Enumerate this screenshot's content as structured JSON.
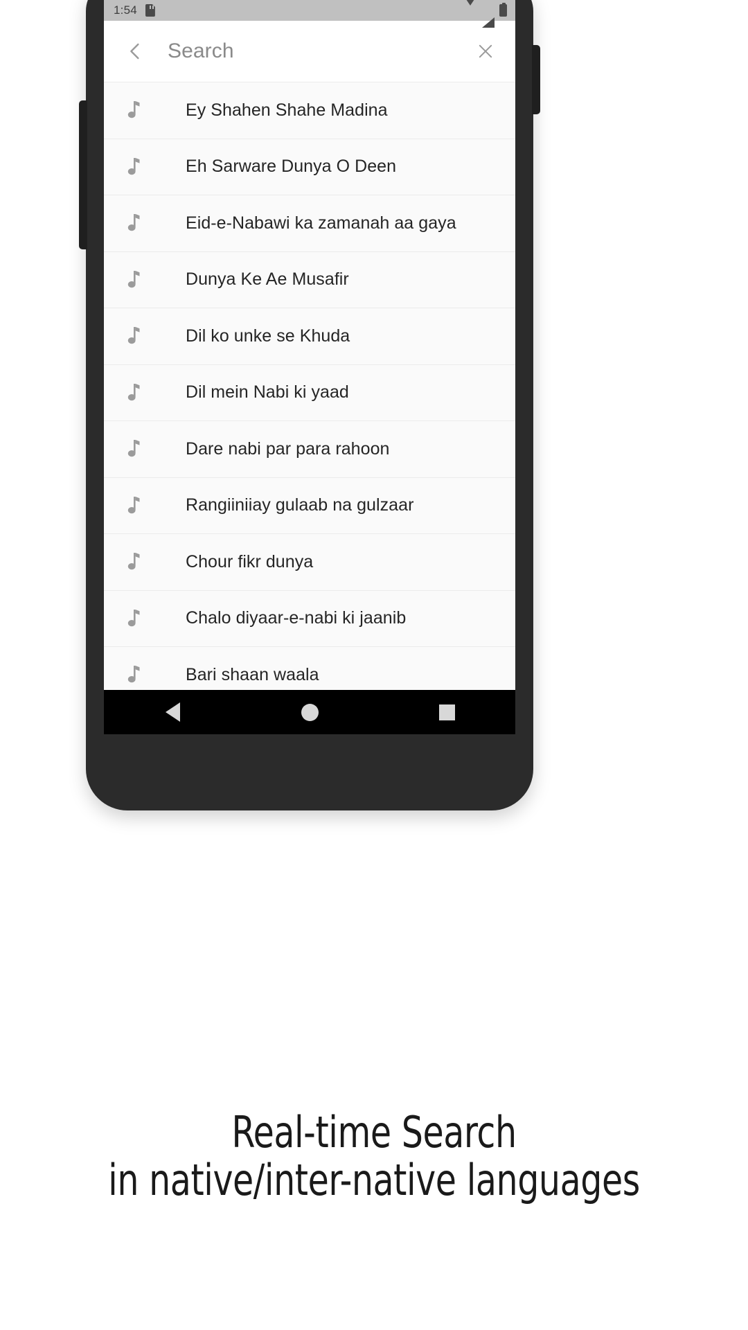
{
  "status_bar": {
    "time": "1:54",
    "left_icons": [
      "sd-card-icon"
    ],
    "right_icons": [
      "wifi-icon",
      "cellular-signal-icon",
      "battery-icon"
    ],
    "background_color": "#c0c0c0"
  },
  "app_bar": {
    "back_icon": "back-chevron-icon",
    "title": "Search",
    "title_color": "#8a8a8a",
    "clear_icon": "close-x-icon"
  },
  "results": {
    "row_icon": "music-note-icon",
    "items": [
      {
        "title": "Ey Shahen Shahe Madina"
      },
      {
        "title": "Eh Sarware Dunya O Deen"
      },
      {
        "title": "Eid-e-Nabawi  ka zamanah aa gaya"
      },
      {
        "title": "Dunya Ke Ae Musafir"
      },
      {
        "title": "Dil ko unke se Khuda"
      },
      {
        "title": "Dil mein Nabi ki yaad"
      },
      {
        "title": "Dare nabi par para rahoon"
      },
      {
        "title": "Rangiiniiay gulaab na gulzaar"
      },
      {
        "title": "Chour fikr dunya"
      },
      {
        "title": "Chalo diyaar-e-nabi ki jaanib"
      },
      {
        "title": "Bari shaan waala"
      }
    ]
  },
  "nav_bar": {
    "back_label": "back-triangle-icon",
    "home_label": "home-circle-icon",
    "recents_label": "recents-square-icon",
    "background_color": "#000000"
  },
  "caption": {
    "line1": "Real-time Search",
    "line2": "in native/inter-native languages"
  }
}
